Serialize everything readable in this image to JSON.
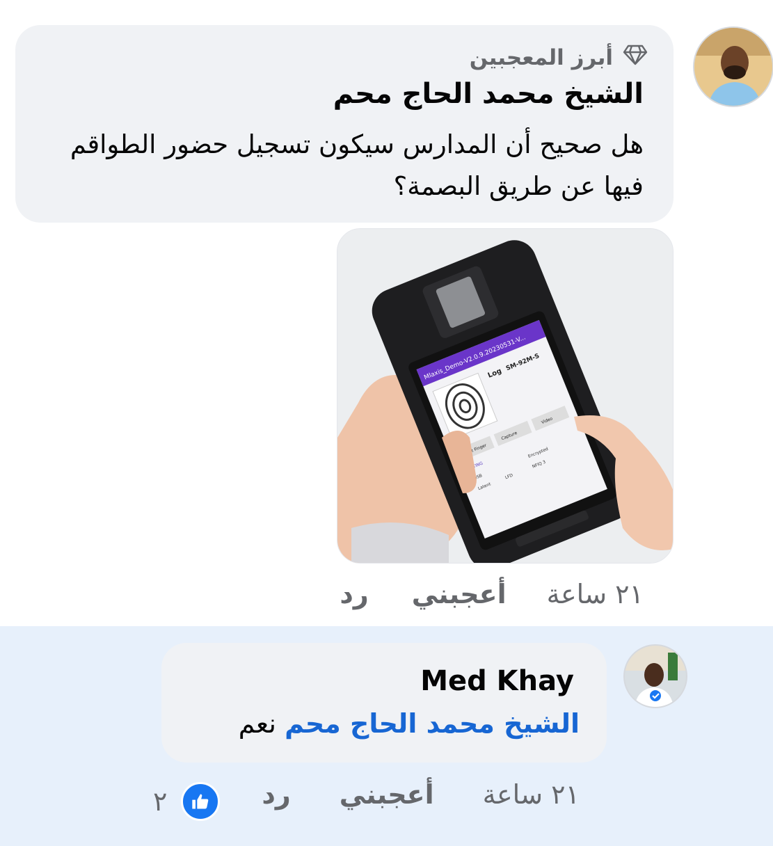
{
  "colors": {
    "mention": "#1766d3",
    "secondary_text": "#65676b",
    "reply_highlight_bg": "#e7f0fb",
    "bubble_bg": "#f0f2f5",
    "like_badge": "#1877f2"
  },
  "comment": {
    "badge_icon": "diamond-icon",
    "badge_label": "أبرز المعجبين",
    "author": "الشيخ محمد الحاج محم",
    "text": "هل صحيح أن المدارس سيكون تسجيل حضور الطواقم فيها عن طريق البصمة؟",
    "attachment": {
      "device_app_title": "Mlaxis_Demo-V2.0.9.20230531-V...",
      "device_log_label": "Log",
      "device_model": "SM-92M-S",
      "device_buttons": [
        "Detect Finger",
        "Capture",
        "Video"
      ],
      "device_settings_tab": "SETTING",
      "device_checkboxes": [
        "USB",
        "Encrypted",
        "Latent",
        "LFD",
        "NFIQ 3"
      ]
    },
    "time": "٢١ ساعة",
    "like_label": "أعجبني",
    "reply_label": "رد"
  },
  "reply": {
    "author": "Med Khay",
    "mention": "الشيخ محمد الحاج محم",
    "text": "نعم",
    "time": "٢١ ساعة",
    "like_label": "أعجبني",
    "reply_label": "رد",
    "reaction_icon": "thumbs-up-icon",
    "reaction_count": "٢"
  }
}
